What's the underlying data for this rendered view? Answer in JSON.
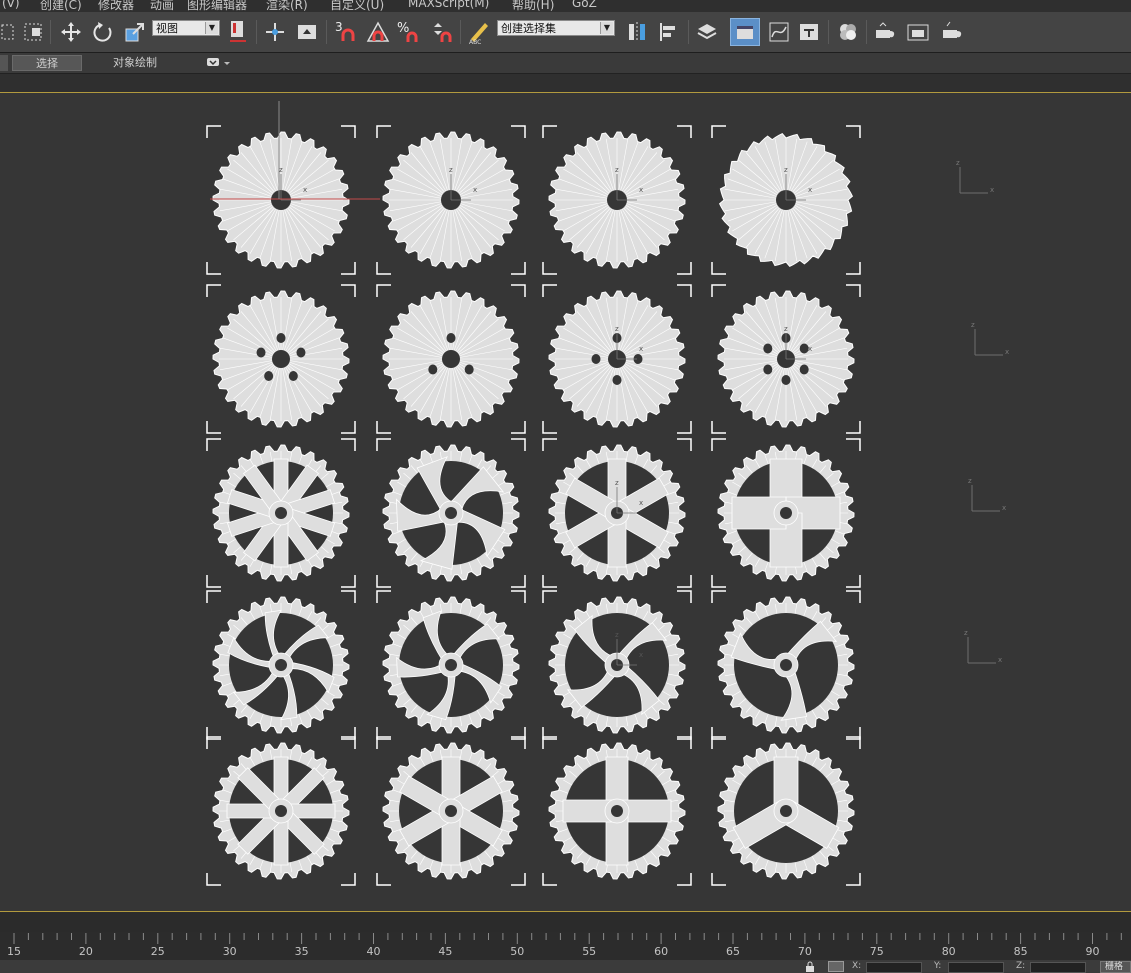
{
  "menubar": {
    "items": [
      "(V)",
      "创建(C)",
      "修改器",
      "动画",
      "图形编辑器",
      "渲染(R)",
      "自定义(U)",
      "MAXScript(M)",
      "帮助(H)",
      "GoZ"
    ]
  },
  "toolbar": {
    "reference_coord": "视图",
    "named_selection": "创建选择集",
    "snap_angle_label": "3",
    "spinner_snap_label": "%"
  },
  "ribbon": {
    "tabs": [
      {
        "label": "选择",
        "active": true
      },
      {
        "label": "对象绘制",
        "active": false
      }
    ]
  },
  "viewport": {
    "background_color": "#363636",
    "wire_color": "#ffffff",
    "gear_fill": "#dedede",
    "gear_grid": {
      "rows": 5,
      "columns": 4,
      "styles": [
        [
          "solid",
          "solid",
          "solid",
          "saw"
        ],
        [
          "holes5",
          "holes3",
          "holes4",
          "holes6"
        ],
        [
          "spokes10",
          "curved5",
          "spokes6",
          "windows4"
        ],
        [
          "swirl6",
          "swirl5",
          "swirl4",
          "swirl3"
        ],
        [
          "spokes8",
          "spokes6wide",
          "spokes4wide",
          "spokes3wide"
        ]
      ]
    },
    "axis_labels": {
      "x": "x",
      "z": "z"
    }
  },
  "timeline": {
    "ticks": [
      "15",
      "20",
      "25",
      "30",
      "35",
      "40",
      "45",
      "50",
      "55",
      "60",
      "65",
      "70",
      "75",
      "80",
      "85",
      "90"
    ]
  },
  "statusbar": {
    "x_label": "X:",
    "y_label": "Y:",
    "z_label": "Z:",
    "grid_button": "栅格"
  }
}
